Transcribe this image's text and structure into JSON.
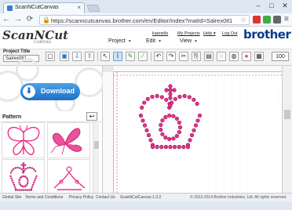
{
  "browser": {
    "tab_title": "ScanNCutCanvas",
    "tab_close": "×",
    "url": "https://scanncutcanvas.brother.com/en/Editor/Index?matId=Salrex0tl1",
    "window_buttons": [
      "–",
      "□",
      "✕"
    ],
    "nav_icons": [
      "←",
      "→",
      "⟳"
    ],
    "star": "☆",
    "lock": "🔒"
  },
  "site": {
    "logo_text": "ScanNCut",
    "logo_sub": "CANVAS",
    "brand": "brother",
    "top_links": {
      "user": "kaenells",
      "my_projects": "My Projects",
      "help": "Help ▾",
      "logout": "Log Out"
    },
    "menu": [
      {
        "label": "Project"
      },
      {
        "label": "Edit"
      },
      {
        "label": "View"
      }
    ]
  },
  "toolbar": {
    "project_title_label": "Project Title",
    "project_title_value": "Salrex0tl1",
    "zoom_value": "100",
    "tools": [
      {
        "name": "new-mat-tool",
        "glyph": "▢"
      },
      {
        "name": "save-tool",
        "glyph": "▣"
      },
      {
        "name": "import-tool",
        "glyph": "⇩"
      },
      {
        "name": "export-tool",
        "glyph": "⇪"
      },
      {
        "name": "select-tool",
        "glyph": "↖"
      },
      {
        "name": "node-edit-tool",
        "glyph": "⌇"
      },
      {
        "name": "pen-tool",
        "glyph": "✎"
      },
      {
        "name": "brush-tool",
        "glyph": "⁄"
      },
      {
        "name": "undo-tool",
        "glyph": "↶"
      },
      {
        "name": "redo-tool",
        "glyph": "↷"
      },
      {
        "name": "cut-tool",
        "glyph": "✂"
      },
      {
        "name": "copy-tool",
        "glyph": "⎘"
      },
      {
        "name": "paste-tool",
        "glyph": "▤"
      },
      {
        "name": "group-tool",
        "glyph": "◌"
      },
      {
        "name": "shape-tool",
        "glyph": "◍"
      },
      {
        "name": "color-tool",
        "glyph": "●"
      },
      {
        "name": "mat-tool",
        "glyph": "▦"
      }
    ]
  },
  "left_panel": {
    "download_label": "Download",
    "download_icon": "⬇",
    "pattern_title": "Pattern",
    "back_glyph": "↩"
  },
  "footer": {
    "links": [
      "Global Site",
      "Terms and Conditions",
      "Privacy Policy",
      "Contact Us",
      "ScanNCutCanvas 1.3.2"
    ],
    "copyright": "© 2013-2014 Brother Industries, Ltd. All rights reserved."
  },
  "colors": {
    "accent": "#e8318a",
    "brand": "#0a3a8c",
    "download": "#2a7fd0"
  }
}
